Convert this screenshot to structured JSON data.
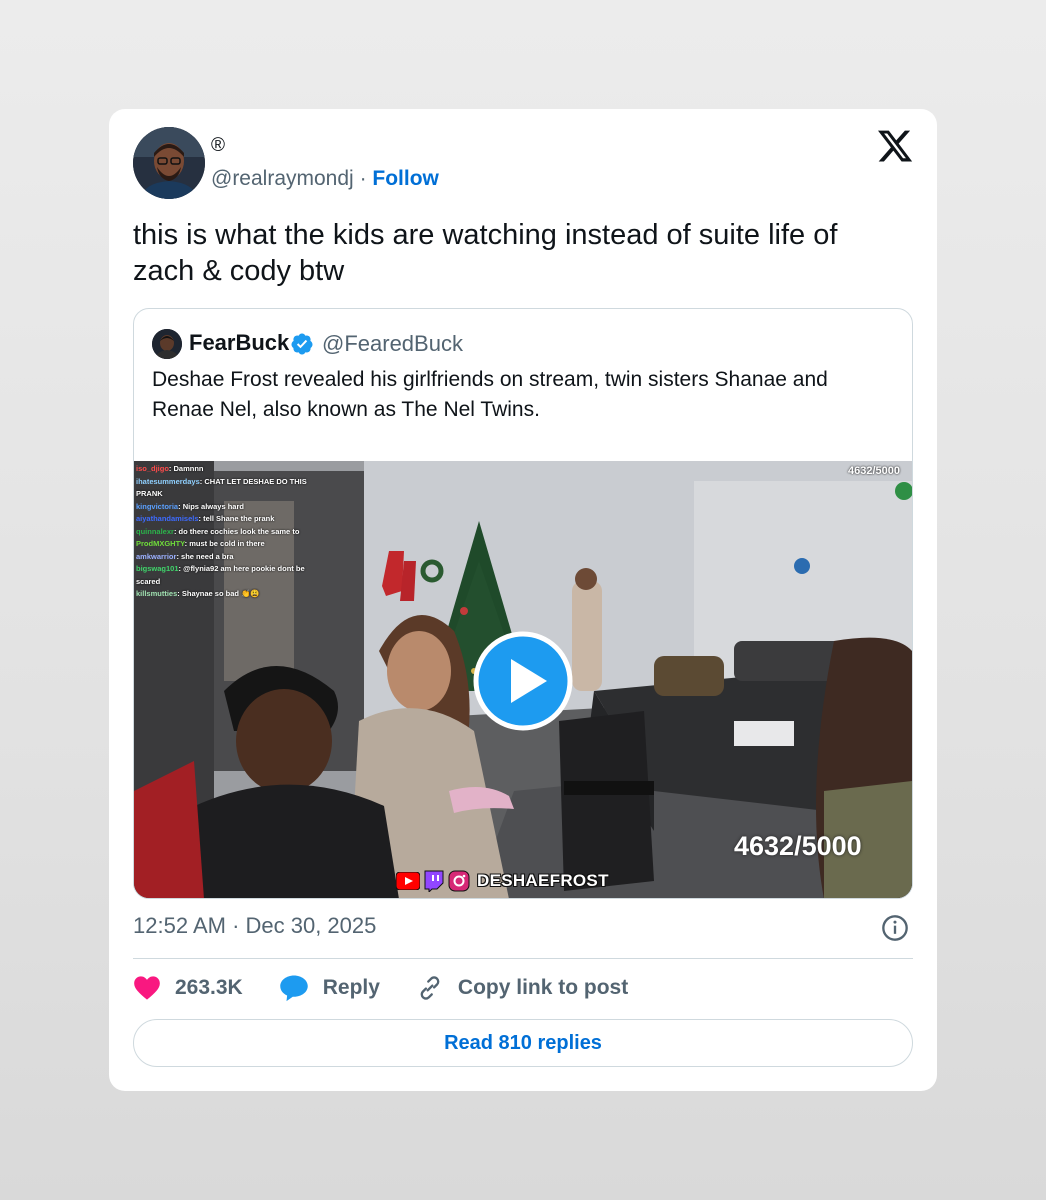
{
  "tweet": {
    "display_name": "®",
    "handle": "@realraymondj",
    "separator": "·",
    "follow_label": "Follow",
    "text": "this is what the kids are watching instead of suite life of zach & cody btw",
    "timestamp": "12:52 AM · Dec 30, 2025"
  },
  "quote": {
    "name": "FearBuck",
    "handle": "@FearedBuck",
    "text": "Deshae Frost revealed his girlfriends on stream, twin sisters Shanae and Renae Nel, also known as The Nel Twins."
  },
  "video": {
    "counter_small": "4632/5000",
    "counter_big": "4632/5000",
    "brand": "DESHAEFROST",
    "chat": [
      {
        "user": "iso_djigo",
        "msg": "Damnnn",
        "color": "#ff4b4b"
      },
      {
        "user": "ihatesummerdays",
        "msg": "CHAT LET DESHAE DO THIS PRANK",
        "color": "#8fd0ff"
      },
      {
        "user": "kingvictoria",
        "msg": "Nips always hard",
        "color": "#5aa0ff"
      },
      {
        "user": "aiyathandamisels",
        "msg": "tell Shane the prank",
        "color": "#3d6bff"
      },
      {
        "user": "quinnalexr",
        "msg": "do there cochies look the same to",
        "color": "#2bb34a"
      },
      {
        "user": "ProdMXGHTY",
        "msg": "must be cold in there",
        "color": "#6fdc3a"
      },
      {
        "user": "amkwarrior",
        "msg": "she need a bra",
        "color": "#9bb0ff"
      },
      {
        "user": "bigswag101",
        "msg": "@flynia92 am here pookie dont be scared",
        "color": "#3fd36a"
      },
      {
        "user": "killsmutties",
        "msg": "Shaynae so bad 👏😩",
        "color": "#9fe0b0"
      }
    ]
  },
  "actions": {
    "likes": "263.3K",
    "reply_label": "Reply",
    "copy_label": "Copy link to post"
  },
  "read_replies_label": "Read 810 replies",
  "colors": {
    "accent": "#006fd6",
    "like": "#f91880",
    "reply_icon": "#1d9bf0",
    "play": "#1d9bf0",
    "muted_text": "#536471"
  }
}
